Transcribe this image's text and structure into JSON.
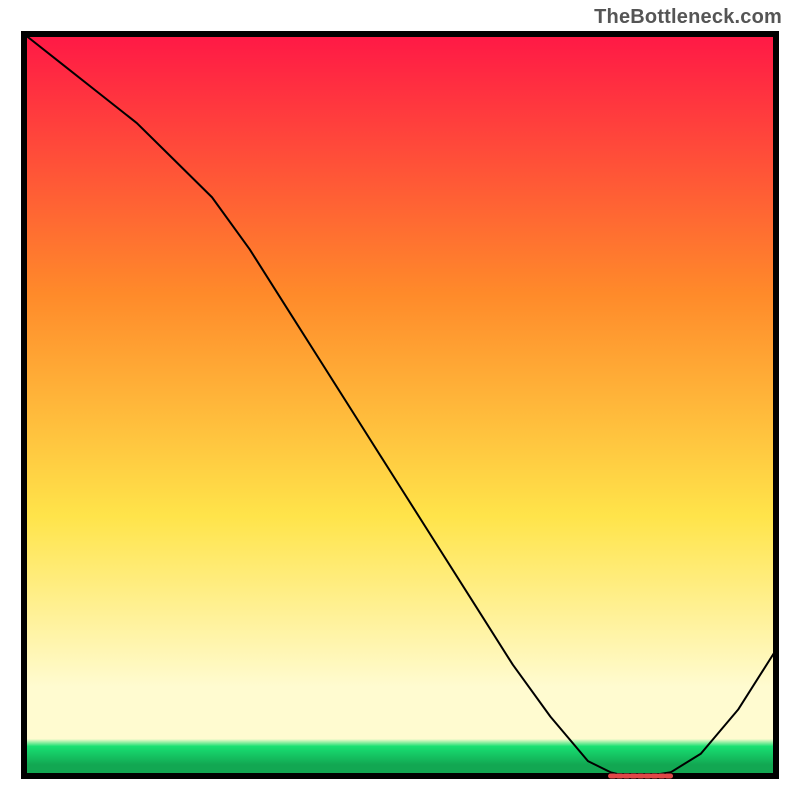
{
  "watermark": "TheBottleneck.com",
  "chart_data": {
    "type": "line",
    "title": "",
    "xlabel": "",
    "ylabel": "",
    "xlim": [
      0,
      100
    ],
    "ylim": [
      0,
      100
    ],
    "grid": false,
    "legend": false,
    "series": [
      {
        "name": "curve",
        "x": [
          0,
          5,
          10,
          15,
          20,
          25,
          30,
          35,
          40,
          45,
          50,
          55,
          60,
          65,
          70,
          75,
          78,
          80,
          83,
          86,
          90,
          95,
          100
        ],
        "y": [
          100,
          96,
          92,
          88,
          83,
          78,
          71,
          63,
          55,
          47,
          39,
          31,
          23,
          15,
          8,
          2,
          0.5,
          0,
          0,
          0.5,
          3,
          9,
          17
        ]
      }
    ],
    "highlight_segment": {
      "name": "flat-minimum",
      "x_start": 78,
      "x_end": 86,
      "color": "#e04848"
    },
    "style": {
      "background_gradient": {
        "top": "#ff1846",
        "mid1": "#ff8a2a",
        "mid2": "#ffe44a",
        "low": "#fffbd0",
        "bottom_band": "#18e072",
        "bottom_accent": "#12a752",
        "border": "#000000"
      },
      "line_color": "#000000",
      "line_width": 2
    }
  }
}
